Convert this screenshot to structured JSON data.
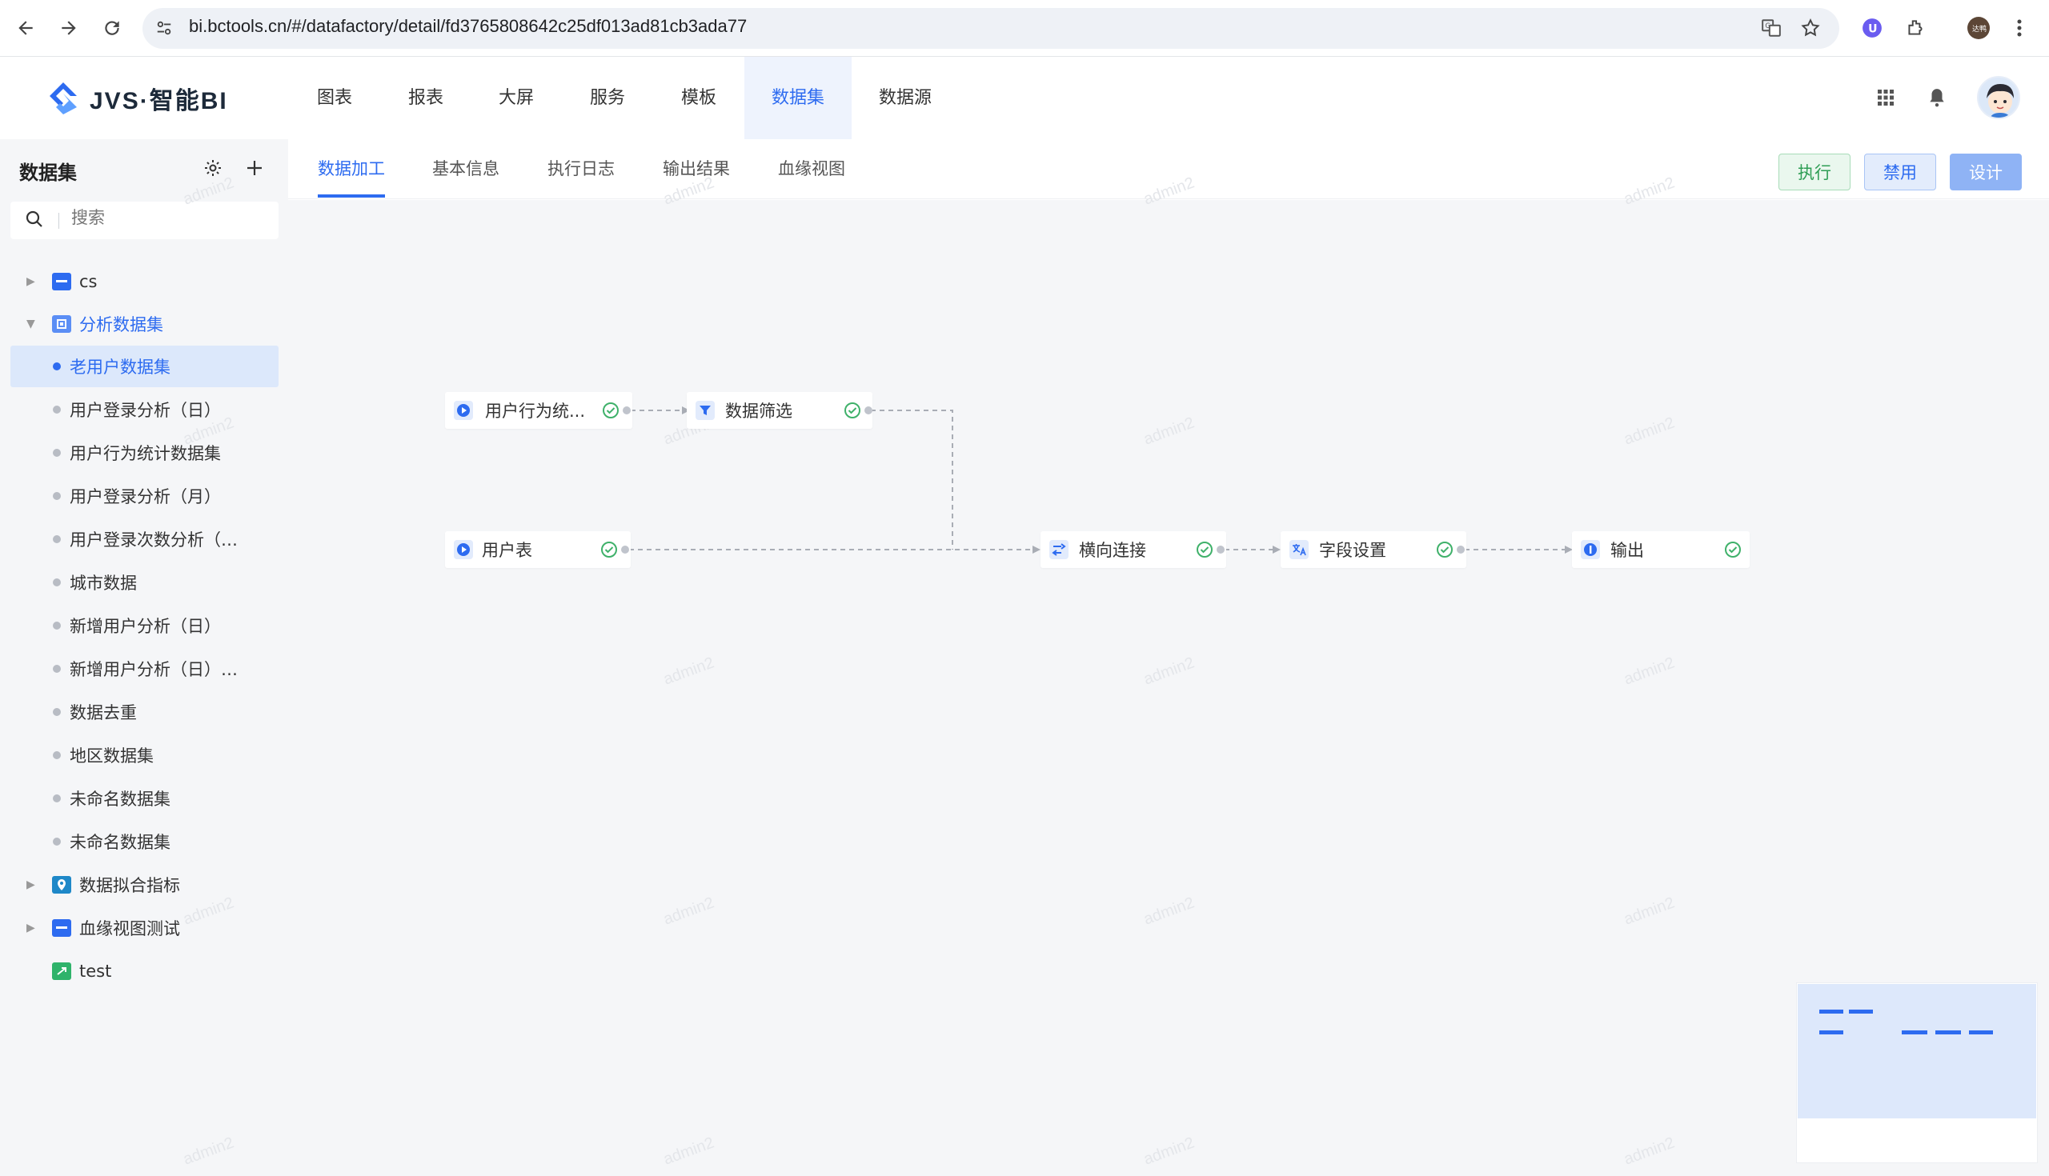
{
  "browser": {
    "url": "bi.bctools.cn/#/datafactory/detail/fd3765808642c25df013ad81cb3ada77",
    "profile_initials": "达鸭"
  },
  "app": {
    "brand": "JVS·智能BI",
    "accent_color": "#2d6bf0",
    "nav": [
      {
        "label": "图表"
      },
      {
        "label": "报表"
      },
      {
        "label": "大屏"
      },
      {
        "label": "服务"
      },
      {
        "label": "模板"
      },
      {
        "label": "数据集",
        "active": true
      },
      {
        "label": "数据源"
      }
    ]
  },
  "sidebar": {
    "title": "数据集",
    "search_placeholder": "搜索",
    "folders": [
      {
        "label": "cs",
        "expanded": false,
        "icon": "folder-icon"
      },
      {
        "label": "分析数据集",
        "expanded": true,
        "icon": "dataset-folder-icon"
      }
    ],
    "items": [
      {
        "label": "老用户数据集",
        "selected": true
      },
      {
        "label": "用户登录分析（日）"
      },
      {
        "label": "用户行为统计数据集"
      },
      {
        "label": "用户登录分析（月）"
      },
      {
        "label": "用户登录次数分析（…"
      },
      {
        "label": "城市数据"
      },
      {
        "label": "新增用户分析（日）"
      },
      {
        "label": "新增用户分析（日）…"
      },
      {
        "label": "数据去重"
      },
      {
        "label": "地区数据集"
      },
      {
        "label": "未命名数据集"
      },
      {
        "label": "未命名数据集"
      }
    ],
    "bottom_folders": [
      {
        "label": "数据拟合指标",
        "icon": "indicator-folder-icon"
      },
      {
        "label": "血缘视图测试",
        "icon": "folder-icon"
      },
      {
        "label": "test",
        "icon": "test-folder-icon"
      }
    ]
  },
  "tabs": [
    {
      "label": "数据加工",
      "active": true
    },
    {
      "label": "基本信息"
    },
    {
      "label": "执行日志"
    },
    {
      "label": "输出结果"
    },
    {
      "label": "血缘视图"
    }
  ],
  "actions": {
    "run": "执行",
    "disable": "禁用",
    "design": "设计"
  },
  "flow": {
    "nodes": [
      {
        "label": "用户行为统...",
        "type": "input",
        "status": "success"
      },
      {
        "label": "数据筛选",
        "type": "filter",
        "status": "success"
      },
      {
        "label": "用户表",
        "type": "input",
        "status": "success"
      },
      {
        "label": "横向连接",
        "type": "join",
        "status": "success"
      },
      {
        "label": "字段设置",
        "type": "field-settings",
        "status": "success"
      },
      {
        "label": "输出",
        "type": "output",
        "status": "success"
      }
    ],
    "watermark": "admin2"
  }
}
